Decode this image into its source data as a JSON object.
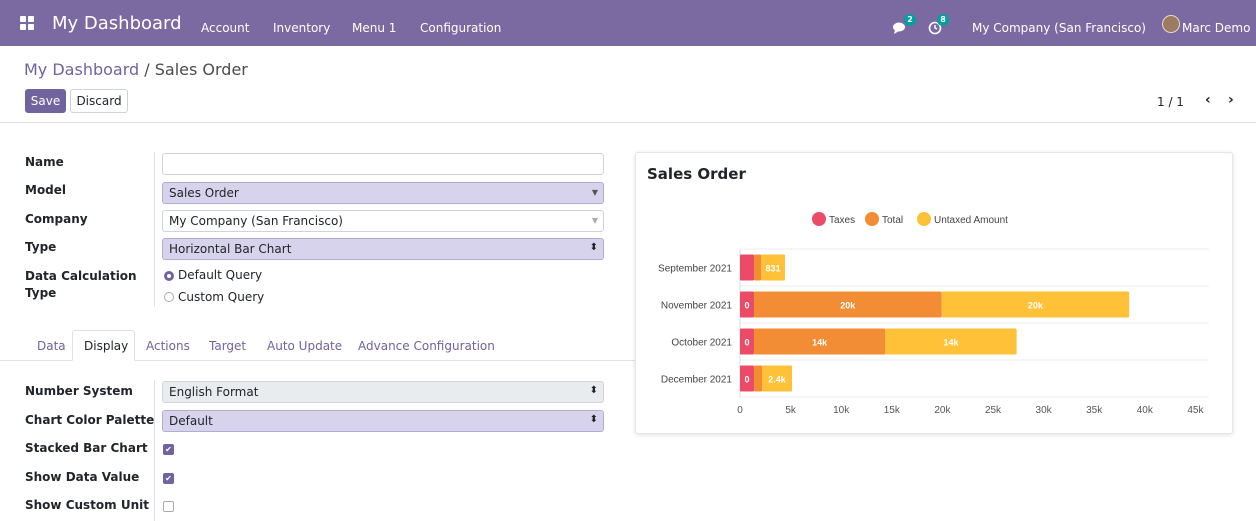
{
  "navbar": {
    "brand": "My Dashboard",
    "menus": [
      "Account",
      "Inventory",
      "Menu 1",
      "Configuration"
    ],
    "messages_count": "2",
    "activities_count": "8",
    "company": "My Company (San Francisco)",
    "user": "Marc Demo"
  },
  "breadcrumb": {
    "parent": "My Dashboard",
    "separator": " / ",
    "current": "Sales Order"
  },
  "buttons": {
    "save": "Save",
    "discard": "Discard"
  },
  "pager": {
    "text": "1 / 1",
    "prev": "‹",
    "next": "›"
  },
  "form": {
    "name_label": "Name",
    "name_value": "",
    "model_label": "Model",
    "model_value": "Sales Order",
    "company_label": "Company",
    "company_value": "My Company (San Francisco)",
    "type_label": "Type",
    "type_value": "Horizontal Bar Chart",
    "calc_label_1": "Data Calculation",
    "calc_label_2": "Type",
    "calc_options": [
      "Default Query",
      "Custom Query"
    ],
    "calc_selected": "Default Query"
  },
  "tabs": [
    "Data",
    "Display",
    "Actions",
    "Target",
    "Auto Update",
    "Advance Configuration"
  ],
  "active_tab": "Display",
  "display": {
    "number_system_label": "Number System",
    "number_system_value": "English Format",
    "palette_label": "Chart Color Palette",
    "palette_value": "Default",
    "stacked_label": "Stacked Bar Chart",
    "stacked_checked": true,
    "show_value_label": "Show Data Value",
    "show_value_checked": true,
    "custom_unit_label": "Show Custom Unit",
    "custom_unit_checked": false
  },
  "colors": {
    "navbar": "#7b6aa1",
    "primary": "#71639e",
    "taxes": "#ec4b67",
    "total": "#f28c35",
    "untaxed": "#fec137"
  },
  "chart_data": {
    "type": "bar",
    "orientation": "horizontal",
    "stacked": true,
    "title": "Sales Order",
    "categories": [
      "September 2021",
      "November 2021",
      "October 2021",
      "December 2021"
    ],
    "series": [
      {
        "name": "Taxes",
        "values": [
          0,
          0,
          0,
          0
        ],
        "labels": [
          "",
          "0",
          "0",
          "0"
        ]
      },
      {
        "name": "Total",
        "values": [
          831,
          20000,
          14000,
          2400
        ],
        "labels": [
          "",
          "20k",
          "14k",
          ""
        ]
      },
      {
        "name": "Untaxed Amount",
        "values": [
          831,
          20000,
          14000,
          2400
        ],
        "labels": [
          "831",
          "20k",
          "14k",
          "2.4k"
        ]
      }
    ],
    "xticks": [
      "0",
      "5k",
      "10k",
      "15k",
      "20k",
      "25k",
      "30k",
      "35k",
      "40k",
      "45k",
      "45k"
    ],
    "xlim": [
      0,
      50000
    ],
    "grid": true,
    "legend_position": "top-center"
  }
}
